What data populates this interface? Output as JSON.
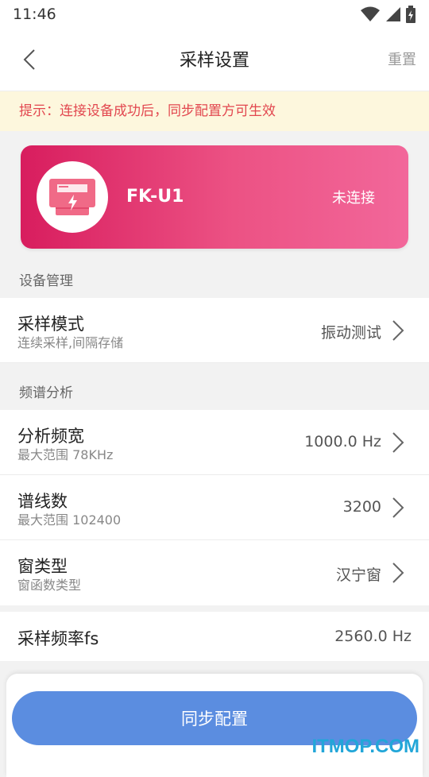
{
  "statusbar": {
    "time": "11:46"
  },
  "appbar": {
    "title": "采样设置",
    "reset_label": "重置"
  },
  "tip": {
    "text": "提示：连接设备成功后，同步配置方可生效"
  },
  "device": {
    "name": "FK-U1",
    "status": "未连接"
  },
  "sections": {
    "device_management": "设备管理",
    "spectrum_analysis": "频谱分析"
  },
  "rows": {
    "sampling_mode": {
      "label": "采样模式",
      "sub": "连续采样,间隔存储",
      "value": "振动测试"
    },
    "analysis_bandwidth": {
      "label": "分析频宽",
      "sub": "最大范围 78KHz",
      "value": "1000.0 Hz"
    },
    "spectral_lines": {
      "label": "谱线数",
      "sub": "最大范围 102400",
      "value": "3200"
    },
    "window_type": {
      "label": "窗类型",
      "sub": "窗函数类型",
      "value": "汉宁窗"
    },
    "sampling_frequency": {
      "label": "采样频率fs",
      "value": "2560.0 Hz"
    }
  },
  "sync_button": {
    "label": "同步配置"
  },
  "watermark": "ITMOP.COM",
  "colors": {
    "accent": "#5b8de0",
    "card_start": "#d81d5e",
    "card_end": "#f2679a",
    "tip_text": "#e2474f"
  }
}
